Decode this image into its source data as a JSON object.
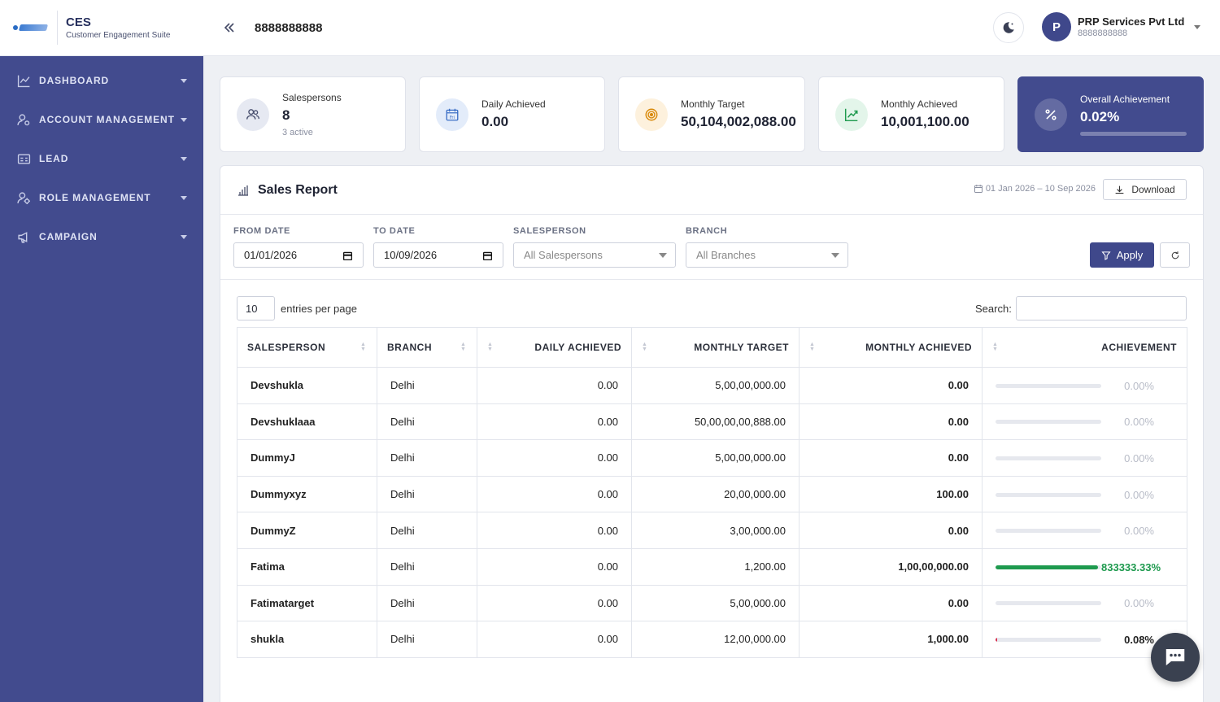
{
  "brand": {
    "title": "CES",
    "subtitle": "Customer Engagement Suite"
  },
  "sidebar": {
    "items": [
      {
        "label": "DASHBOARD",
        "icon": "line-chart-icon"
      },
      {
        "label": "ACCOUNT MANAGEMENT",
        "icon": "user-gear-icon"
      },
      {
        "label": "LEAD",
        "icon": "id-card-icon"
      },
      {
        "label": "ROLE MANAGEMENT",
        "icon": "user-cog-icon"
      },
      {
        "label": "CAMPAIGN",
        "icon": "megaphone-icon"
      }
    ]
  },
  "header": {
    "title": "8888888888"
  },
  "user": {
    "initial": "P",
    "name": "PRP Services Pvt Ltd",
    "phone": "8888888888"
  },
  "stats": {
    "salespersons": {
      "label": "Salespersons",
      "value": "8",
      "sub": "3 active"
    },
    "daily": {
      "label": "Daily Achieved",
      "value": "0.00"
    },
    "monthly_target": {
      "label": "Monthly Target",
      "value": "50,104,002,088.00"
    },
    "monthly_achieved": {
      "label": "Monthly Achieved",
      "value": "10,001,100.00"
    },
    "overall": {
      "label": "Overall Achievement",
      "value": "0.02%",
      "fraction": 0.0002
    }
  },
  "report": {
    "title": "Sales Report",
    "date_range": "01 Jan 2026 – 10 Sep 2026",
    "download_label": "Download"
  },
  "filters": {
    "from_label": "FROM DATE",
    "from_value": "01/01/2026",
    "to_label": "TO DATE",
    "to_value": "10/09/2026",
    "salesperson_label": "SALESPERSON",
    "salesperson_value": "All Salespersons",
    "branch_label": "BRANCH",
    "branch_value": "All Branches",
    "apply_label": "Apply"
  },
  "table_tools": {
    "entries_value": "10",
    "entries_text": "entries per page",
    "search_label": "Search:"
  },
  "table": {
    "columns": [
      "SALESPERSON",
      "BRANCH",
      "DAILY ACHIEVED",
      "MONTHLY TARGET",
      "MONTHLY ACHIEVED",
      "ACHIEVEMENT"
    ],
    "rows": [
      {
        "name": "Devshukla",
        "branch": "Delhi",
        "daily": "0.00",
        "target": "5,00,00,000.00",
        "achieved": "0.00",
        "pct": "0.00%",
        "fraction": 0,
        "color": "#b8bcc7"
      },
      {
        "name": "Devshuklaaa",
        "branch": "Delhi",
        "daily": "0.00",
        "target": "50,00,00,00,888.00",
        "achieved": "0.00",
        "pct": "0.00%",
        "fraction": 0,
        "color": "#b8bcc7"
      },
      {
        "name": "DummyJ",
        "branch": "Delhi",
        "daily": "0.00",
        "target": "5,00,00,000.00",
        "achieved": "0.00",
        "pct": "0.00%",
        "fraction": 0,
        "color": "#b8bcc7"
      },
      {
        "name": "Dummyxyz",
        "branch": "Delhi",
        "daily": "0.00",
        "target": "20,00,000.00",
        "achieved": "100.00",
        "pct": "0.00%",
        "fraction": 0,
        "color": "#b8bcc7"
      },
      {
        "name": "DummyZ",
        "branch": "Delhi",
        "daily": "0.00",
        "target": "3,00,000.00",
        "achieved": "0.00",
        "pct": "0.00%",
        "fraction": 0,
        "color": "#b8bcc7"
      },
      {
        "name": "Fatima",
        "branch": "Delhi",
        "daily": "0.00",
        "target": "1,200.00",
        "achieved": "1,00,00,000.00",
        "pct": "833333.33%",
        "fraction": 1,
        "color": "#1e9a4e"
      },
      {
        "name": "Fatimatarget",
        "branch": "Delhi",
        "daily": "0.00",
        "target": "5,00,000.00",
        "achieved": "0.00",
        "pct": "0.00%",
        "fraction": 0,
        "color": "#b8bcc7"
      },
      {
        "name": "shukla",
        "branch": "Delhi",
        "daily": "0.00",
        "target": "12,00,000.00",
        "achieved": "1,000.00",
        "pct": "0.08%",
        "fraction": 0.0008,
        "color": "#222222"
      }
    ]
  },
  "colors": {
    "sidebar": "#424b8e",
    "primary": "#3f488b",
    "success": "#1e9a4e",
    "danger": "#d9304f"
  }
}
